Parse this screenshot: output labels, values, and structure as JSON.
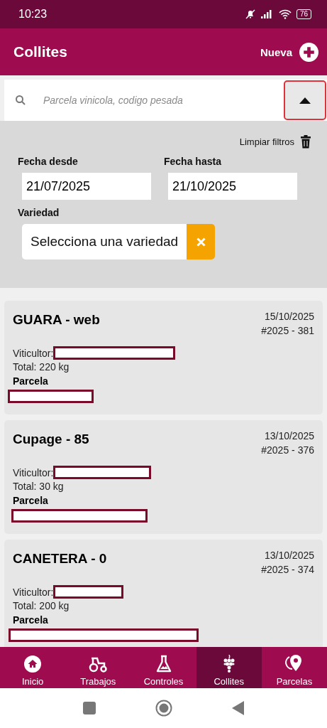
{
  "status_bar": {
    "time": "10:23",
    "battery": "76"
  },
  "app_bar": {
    "title": "Collites",
    "new_button": "Nueva"
  },
  "search": {
    "placeholder": "Parcela vinicola, codigo pesada",
    "filters_expanded": true
  },
  "filters": {
    "clear": "Limpiar filtros",
    "date_from": {
      "label": "Fecha desde",
      "value": "21/07/2025"
    },
    "date_to": {
      "label": "Fecha hasta",
      "value": "21/10/2025"
    },
    "variety": {
      "label": "Variedad",
      "placeholder": "Selecciona una variedad"
    }
  },
  "harvests": [
    {
      "title": "GUARA - web",
      "date": "15/10/2025",
      "code": "#2025 - 381",
      "grower_label": "Viticultor:",
      "total": "Total: 220 kg",
      "plot_label": "Parcela"
    },
    {
      "title": "Cupage - 85",
      "date": "13/10/2025",
      "code": "#2025 - 376",
      "grower_label": "Viticultor:",
      "total": "Total: 30 kg",
      "plot_label": "Parcela"
    },
    {
      "title": "CANETERA - 0",
      "date": "13/10/2025",
      "code": "#2025 - 374",
      "grower_label": "Viticultor:",
      "total": "Total: 200 kg",
      "plot_label": "Parcela"
    }
  ],
  "nav": [
    {
      "label": "Inicio",
      "selected": false
    },
    {
      "label": "Trabajos",
      "selected": false
    },
    {
      "label": "Controles",
      "selected": false
    },
    {
      "label": "Collites",
      "selected": true
    },
    {
      "label": "Parcelas",
      "selected": false
    }
  ]
}
